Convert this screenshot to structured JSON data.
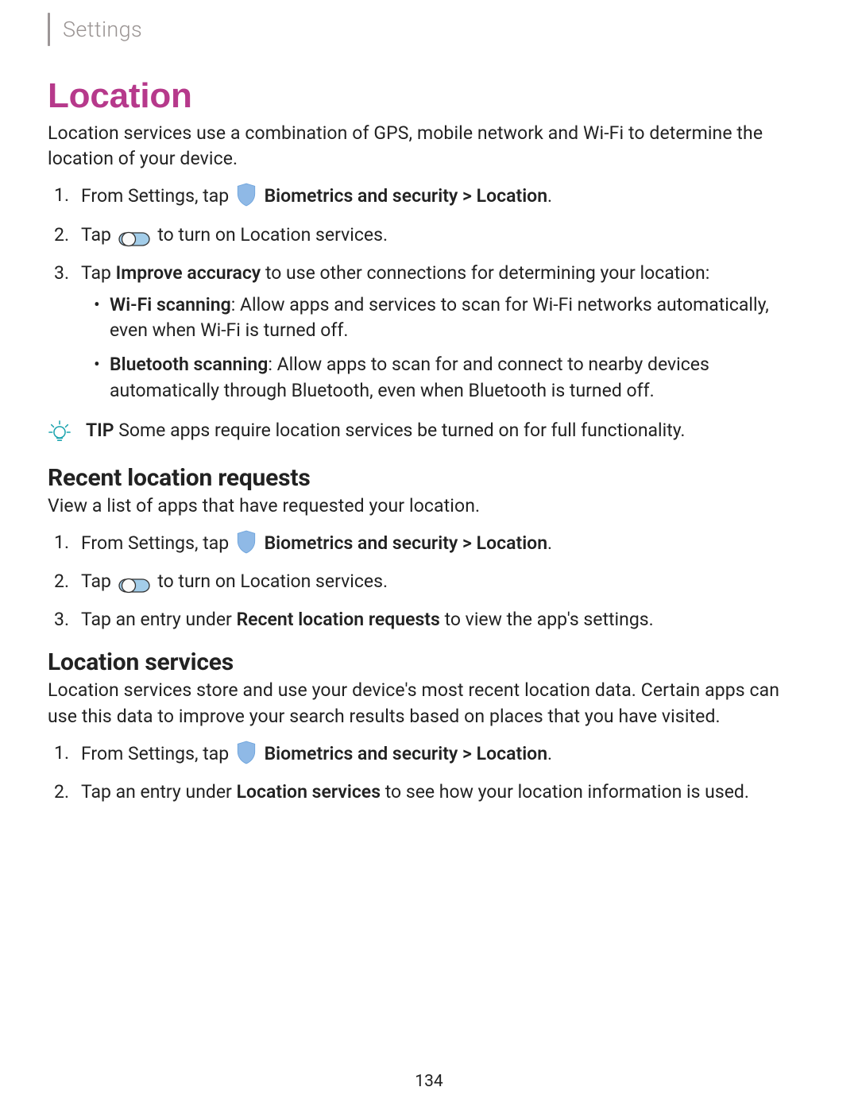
{
  "header": {
    "breadcrumb": "Settings"
  },
  "title": "Location",
  "intro": "Location services use a combination of GPS, mobile network and Wi-Fi to determine the location of your device.",
  "steps1": {
    "s1_pre": "From Settings, tap ",
    "s1_bold": "Biometrics and security > Location",
    "s1_post": ".",
    "s2_pre": "Tap ",
    "s2_post": " to turn on Location services.",
    "s3_pre": "Tap ",
    "s3_bold": "Improve accuracy",
    "s3_post": " to use other connections for determining your location:"
  },
  "bullets": {
    "wifi_label": "Wi-Fi scanning",
    "wifi_text": ": Allow apps and services to scan for Wi-Fi networks automatically, even when Wi-Fi is turned off.",
    "bt_label": "Bluetooth scanning",
    "bt_text": ": Allow apps to scan for and connect to nearby devices automatically through Bluetooth, even when Bluetooth is turned off."
  },
  "tip": {
    "label": "TIP",
    "text": "  Some apps require location services be turned on for full functionality."
  },
  "section_recent": {
    "title": "Recent location requests",
    "intro": "View a list of apps that have requested your location.",
    "s1_pre": "From Settings, tap ",
    "s1_bold": "Biometrics and security > Location",
    "s1_post": ".",
    "s2_pre": "Tap ",
    "s2_post": " to turn on Location services.",
    "s3_pre": "Tap an entry under ",
    "s3_bold": "Recent location requests",
    "s3_post": " to view the app's settings."
  },
  "section_services": {
    "title": "Location services",
    "intro": "Location services store and use your device's most recent location data. Certain apps can use this data to improve your search results based on places that you have visited.",
    "s1_pre": "From Settings, tap ",
    "s1_bold": "Biometrics and security > Location",
    "s1_post": ".",
    "s2_pre": "Tap an entry under ",
    "s2_bold": "Location services",
    "s2_post": " to see how your location information is used."
  },
  "page_number": "134"
}
